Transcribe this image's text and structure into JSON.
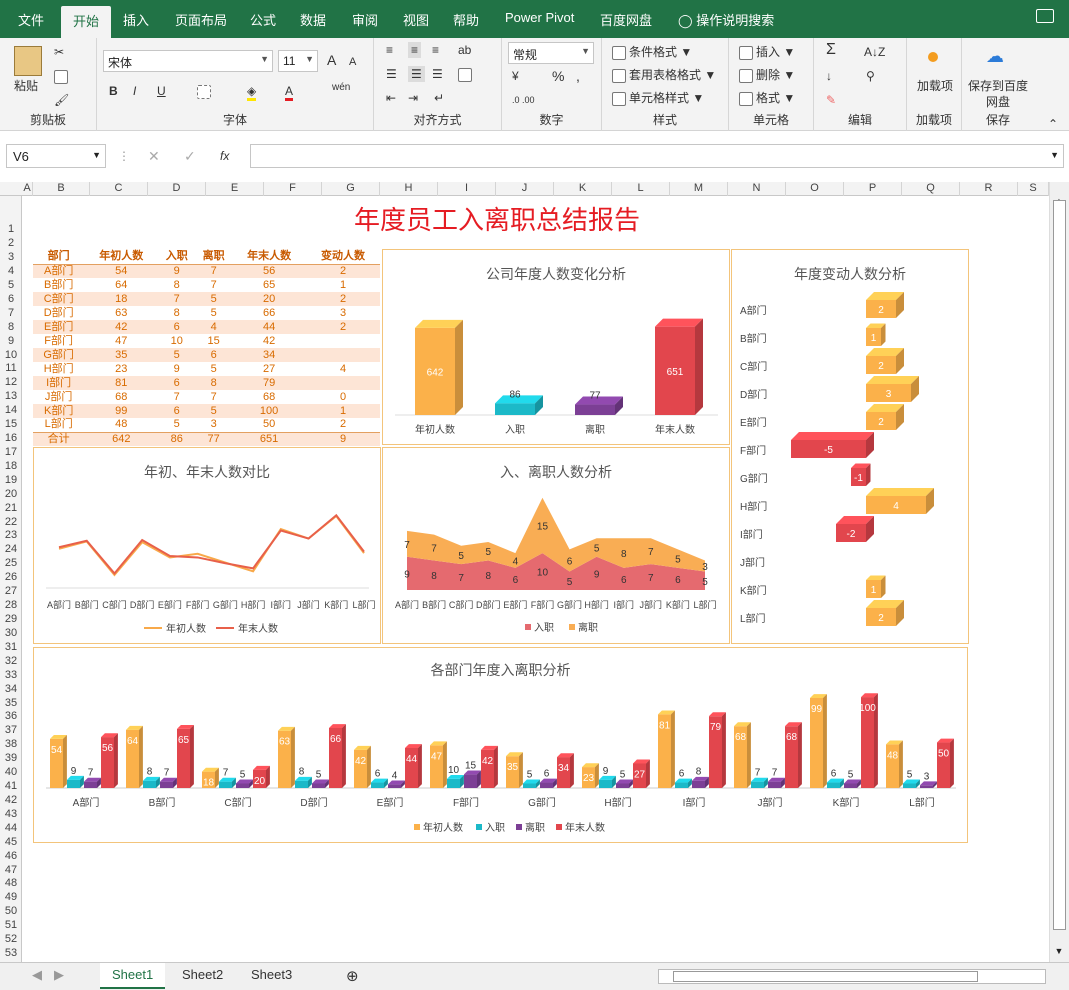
{
  "ribbon_tabs": [
    "文件",
    "开始",
    "插入",
    "页面布局",
    "公式",
    "数据",
    "审阅",
    "视图",
    "帮助",
    "Power Pivot",
    "百度网盘"
  ],
  "search_label": "操作说明搜索",
  "groups": {
    "clipboard": {
      "paste": "粘贴",
      "label": "剪贴板"
    },
    "font": {
      "name": "宋体",
      "size": "11",
      "label": "字体",
      "bold": "B",
      "italic": "I",
      "underline": "U",
      "grow": "A",
      "wen": "wén"
    },
    "align": {
      "label": "对齐方式"
    },
    "number": {
      "format": "常规",
      "label": "数字",
      "percent": "%",
      "comma": ","
    },
    "styles": {
      "cond": "条件格式",
      "table": "套用表格格式",
      "cell": "单元格样式",
      "label": "样式"
    },
    "cells": {
      "insert": "插入",
      "delete": "删除",
      "format": "格式",
      "label": "单元格"
    },
    "edit": {
      "label": "编辑",
      "sigma": "Σ"
    },
    "addin": {
      "btn": "加载项",
      "label": "加载项"
    },
    "save": {
      "btn": "保存到百度网盘",
      "label": "保存"
    }
  },
  "formula_bar": {
    "name_box": "V6",
    "fx": "fx",
    "value": ""
  },
  "columns": [
    "A",
    "B",
    "C",
    "D",
    "E",
    "F",
    "G",
    "H",
    "I",
    "J",
    "K",
    "L",
    "M",
    "N",
    "O",
    "P",
    "Q",
    "R",
    "S"
  ],
  "rows": [
    "1",
    "2",
    "3",
    "4",
    "5",
    "6",
    "7",
    "8",
    "9",
    "10",
    "11",
    "12",
    "13",
    "14",
    "15",
    "16",
    "17",
    "18",
    "19",
    "20",
    "21",
    "22",
    "23",
    "24",
    "25",
    "26",
    "27",
    "28",
    "29",
    "30",
    "31",
    "32",
    "33",
    "34",
    "35",
    "36",
    "37",
    "38",
    "39",
    "40",
    "41",
    "42",
    "43",
    "44",
    "45",
    "46",
    "47",
    "48",
    "49",
    "50",
    "51",
    "52",
    "53"
  ],
  "report_title": "年度员工入离职总结报告",
  "table": {
    "headers": [
      "部门",
      "年初人数",
      "入职",
      "离职",
      "年末人数",
      "变动人数"
    ],
    "rows": [
      [
        "A部门",
        "54",
        "9",
        "7",
        "56",
        "2"
      ],
      [
        "B部门",
        "64",
        "8",
        "7",
        "65",
        "1"
      ],
      [
        "C部门",
        "18",
        "7",
        "5",
        "20",
        "2"
      ],
      [
        "D部门",
        "63",
        "8",
        "5",
        "66",
        "3"
      ],
      [
        "E部门",
        "42",
        "6",
        "4",
        "44",
        "2"
      ],
      [
        "F部门",
        "47",
        "10",
        "15",
        "42",
        ""
      ],
      [
        "G部门",
        "35",
        "5",
        "6",
        "34",
        ""
      ],
      [
        "H部门",
        "23",
        "9",
        "5",
        "27",
        "4"
      ],
      [
        "I部门",
        "81",
        "6",
        "8",
        "79",
        ""
      ],
      [
        "J部门",
        "68",
        "7",
        "7",
        "68",
        "0"
      ],
      [
        "K部门",
        "99",
        "6",
        "5",
        "100",
        "1"
      ],
      [
        "L部门",
        "48",
        "5",
        "3",
        "50",
        "2"
      ]
    ],
    "total": [
      "合计",
      "642",
      "86",
      "77",
      "651",
      "9"
    ]
  },
  "chart_data": [
    {
      "type": "bar",
      "title": "公司年度人数变化分析",
      "categories": [
        "年初人数",
        "入职",
        "离职",
        "年末人数"
      ],
      "values": [
        642,
        86,
        77,
        651
      ],
      "colors": [
        "#fbb14a",
        "#1cb9c8",
        "#7c3f95",
        "#e2464d"
      ]
    },
    {
      "type": "bar",
      "title": "年度变动人数分析",
      "orientation": "horizontal",
      "categories": [
        "A部门",
        "B部门",
        "C部门",
        "D部门",
        "E部门",
        "F部门",
        "G部门",
        "H部门",
        "I部门",
        "J部门",
        "K部门",
        "L部门"
      ],
      "values": [
        2,
        1,
        2,
        3,
        2,
        -5,
        -1,
        4,
        -2,
        0,
        1,
        2
      ]
    },
    {
      "type": "line",
      "title": "年初、年末人数对比",
      "categories": [
        "A部门",
        "B部门",
        "C部门",
        "D部门",
        "E部门",
        "F部门",
        "G部门",
        "H部门",
        "I部门",
        "J部门",
        "K部门",
        "L部门"
      ],
      "series": [
        {
          "name": "年初人数",
          "values": [
            54,
            64,
            18,
            63,
            42,
            47,
            35,
            23,
            81,
            68,
            99,
            48
          ],
          "color": "#f8a94a"
        },
        {
          "name": "年末人数",
          "values": [
            56,
            65,
            20,
            66,
            44,
            42,
            34,
            27,
            79,
            68,
            100,
            50
          ],
          "color": "#e8604a"
        }
      ],
      "legend": "bottom"
    },
    {
      "type": "area",
      "title": "入、离职人数分析",
      "stacked": true,
      "categories": [
        "A部门",
        "B部门",
        "C部门",
        "D部门",
        "E部门",
        "F部门",
        "G部门",
        "H部门",
        "I部门",
        "J部门",
        "K部门",
        "L部门"
      ],
      "series": [
        {
          "name": "入职",
          "values": [
            9,
            8,
            7,
            8,
            6,
            10,
            5,
            9,
            6,
            7,
            6,
            5
          ],
          "color": "#e56a6f"
        },
        {
          "name": "离职",
          "values": [
            7,
            7,
            5,
            5,
            4,
            15,
            6,
            5,
            8,
            7,
            5,
            3
          ],
          "color": "#f9ad54"
        }
      ],
      "legend": "bottom"
    },
    {
      "type": "bar",
      "title": "各部门年度入离职分析",
      "categories": [
        "A部门",
        "B部门",
        "C部门",
        "D部门",
        "E部门",
        "F部门",
        "G部门",
        "H部门",
        "I部门",
        "J部门",
        "K部门",
        "L部门"
      ],
      "series": [
        {
          "name": "年初人数",
          "values": [
            54,
            64,
            18,
            63,
            42,
            47,
            35,
            23,
            81,
            68,
            99,
            48
          ],
          "color": "#fbb14a"
        },
        {
          "name": "入职",
          "values": [
            9,
            8,
            7,
            8,
            6,
            10,
            5,
            9,
            6,
            7,
            6,
            5
          ],
          "color": "#1cb9c8"
        },
        {
          "name": "离职",
          "values": [
            7,
            7,
            5,
            5,
            4,
            15,
            6,
            5,
            8,
            7,
            5,
            3
          ],
          "color": "#7c3f95"
        },
        {
          "name": "年末人数",
          "values": [
            56,
            65,
            20,
            66,
            44,
            42,
            34,
            27,
            79,
            68,
            100,
            50
          ],
          "color": "#e2464d"
        }
      ],
      "legend": "bottom"
    }
  ],
  "sheet_tabs": [
    "Sheet1",
    "Sheet2",
    "Sheet3"
  ]
}
